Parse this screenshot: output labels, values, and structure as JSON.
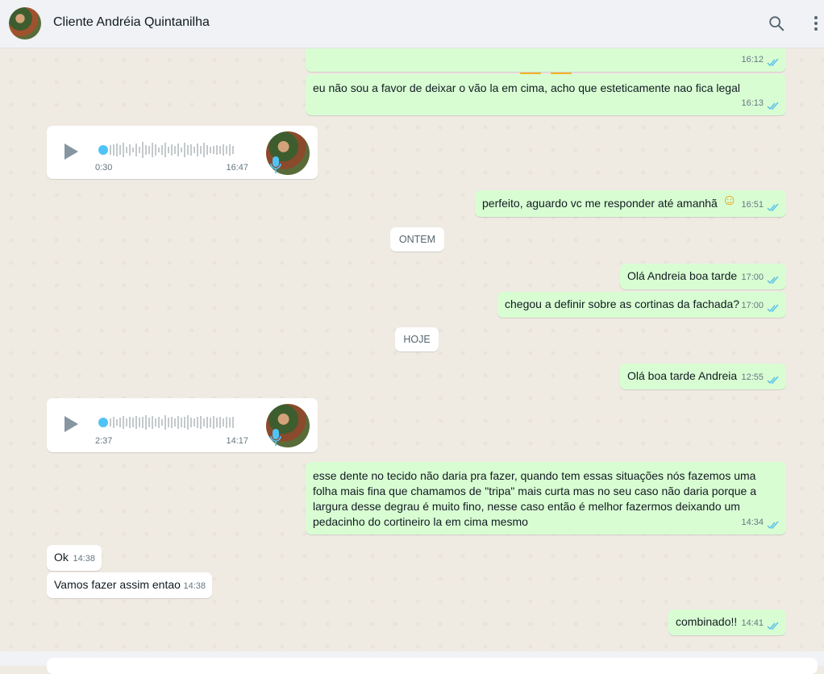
{
  "header": {
    "contact_name": "Cliente Andréia Quintanilha",
    "icons": [
      "search-icon",
      "menu-icon"
    ]
  },
  "messages": [
    {
      "dir": "out",
      "text": "",
      "time": "16:12",
      "emoji": "partial-emoji"
    },
    {
      "dir": "out",
      "text": "eu não sou a favor de deixar o vão la em cima, acho que esteticamente nao fica legal",
      "time": "16:13"
    },
    {
      "dir": "in",
      "type": "audio",
      "duration": "0:30",
      "time": "16:47"
    },
    {
      "dir": "out",
      "text": "perfeito, aguardo vc me responder até amanhã",
      "emoji": "☺",
      "time": "16:51"
    },
    {
      "dir": "out",
      "text": "Olá Andreia boa tarde",
      "time": "17:00"
    },
    {
      "dir": "out",
      "text": "chegou a definir sobre as cortinas da fachada?",
      "time": "17:00"
    },
    {
      "dir": "out",
      "text": "Olá boa tarde Andreia",
      "time": "12:55"
    },
    {
      "dir": "in",
      "type": "audio",
      "duration": "2:37",
      "time": "14:17"
    },
    {
      "dir": "out",
      "text": "esse dente no tecido não daria pra fazer, quando tem essas situações nós fazemos uma folha mais fina que chamamos de \"tripa\" mais curta mas no seu caso não daria porque a largura desse degrau é muito fino, nesse caso então é melhor fazermos deixando um pedacinho do cortineiro la em cima mesmo",
      "time": "14:34"
    },
    {
      "dir": "in",
      "text": "Ok",
      "time": "14:38"
    },
    {
      "dir": "in",
      "text": "Vamos fazer assim entao",
      "time": "14:38"
    },
    {
      "dir": "out",
      "text": "combinado!!",
      "time": "14:41"
    }
  ],
  "date_separators": [
    "ONTEM",
    "HOJE"
  ],
  "colors": {
    "outgoing_bubble": "#d9fdd3",
    "incoming_bubble": "#ffffff",
    "read_ticks": "#53bdeb",
    "chat_background": "#efeae2"
  }
}
